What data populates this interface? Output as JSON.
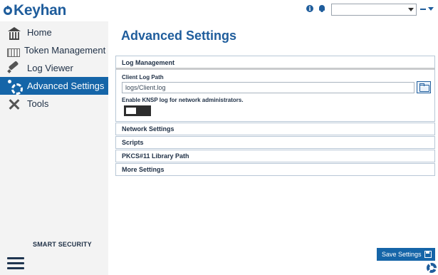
{
  "app": {
    "logo_text": "Keyhan"
  },
  "topbar": {
    "select_value": "",
    "icons": [
      "info-icon",
      "bell-icon",
      "minimize-icon",
      "dropdown-icon"
    ]
  },
  "sidebar": {
    "items": [
      {
        "label": "Home",
        "icon": "home-icon",
        "active": false
      },
      {
        "label": "Token Management",
        "icon": "token-icon",
        "active": false
      },
      {
        "label": "Log Viewer",
        "icon": "log-viewer-icon",
        "active": false
      },
      {
        "label": "Advanced Settings",
        "icon": "advanced-settings-icon",
        "active": true
      },
      {
        "label": "Tools",
        "icon": "tools-icon",
        "active": false
      }
    ],
    "footer_label": "SMART SECURITY"
  },
  "main": {
    "title": "Advanced Settings",
    "log_management": {
      "header": "Log Management",
      "client_log_path_label": "Client Log Path",
      "client_log_path_value": "logs/Client.log",
      "ksnp_label": "Enable KNSP log for network administrators.",
      "ksnp_enabled": false
    },
    "sections": [
      "Network Settings",
      "Scripts",
      "PKCS#11 Library Path",
      "More Settings"
    ],
    "save_label": "Save Settings"
  },
  "colors": {
    "accent": "#1565a8",
    "brand": "#1f5d9c",
    "sidebar_bg": "#f3f3f3"
  }
}
